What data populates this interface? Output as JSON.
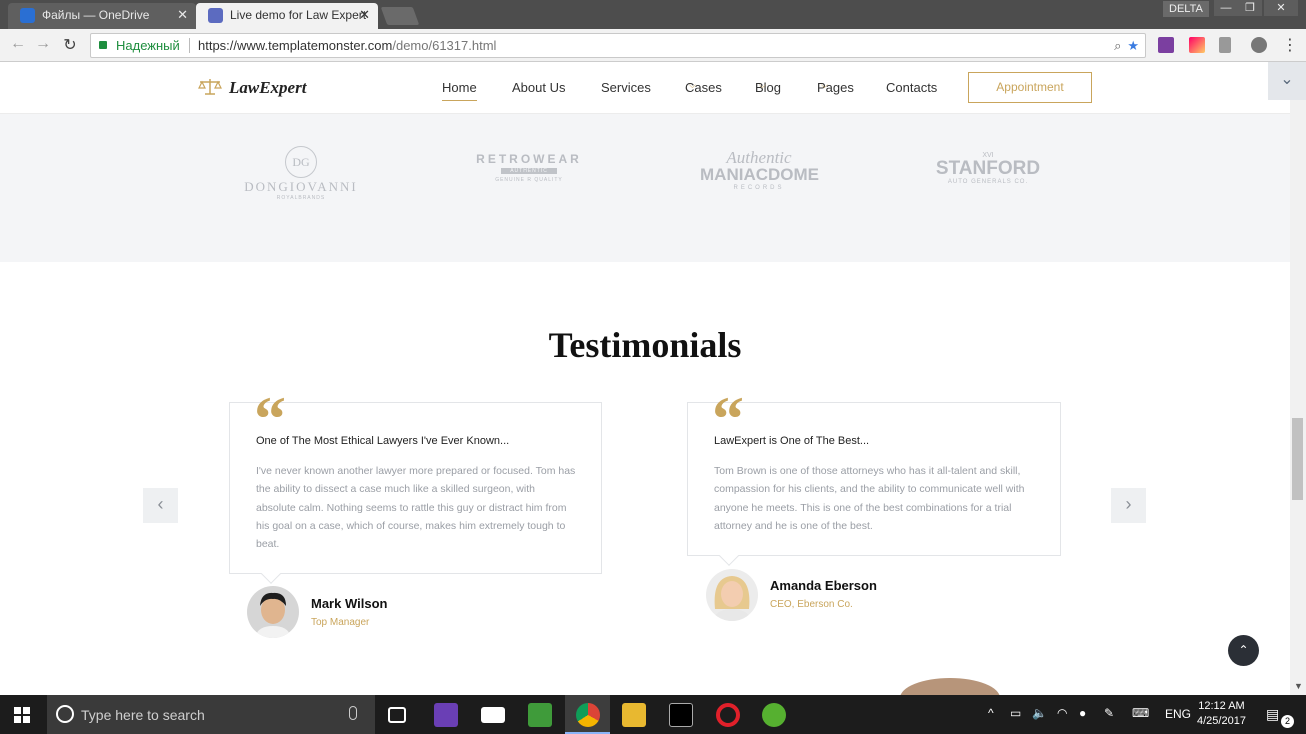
{
  "browser": {
    "tabs": [
      {
        "title": "Файлы — OneDrive",
        "active": false
      },
      {
        "title": "Live demo for Law Expert",
        "active": true
      }
    ],
    "profile": "DELTA",
    "secure_label": "Надежный",
    "url_host": "https://www.templatemonster.com",
    "url_path": "/demo/61317.html"
  },
  "site": {
    "brand": "LawExpert",
    "nav": [
      {
        "label": "Home",
        "dropdown": false,
        "current": true
      },
      {
        "label": "About Us",
        "dropdown": false
      },
      {
        "label": "Services",
        "dropdown": false
      },
      {
        "label": "Cases",
        "dropdown": true
      },
      {
        "label": "Blog",
        "dropdown": true
      },
      {
        "label": "Pages",
        "dropdown": true
      },
      {
        "label": "Contacts",
        "dropdown": false
      }
    ],
    "appointment_label": "Appointment",
    "partner_logos": [
      {
        "lines": [
          "DG",
          "DONGIOVANNI",
          "ROYALBRANDS"
        ]
      },
      {
        "lines": [
          "RETROWEAR",
          "AUTHENTIC",
          "GENUINE R QUALITY"
        ]
      },
      {
        "lines": [
          "Authentic",
          "MANIACDOME",
          "RECORDS"
        ]
      },
      {
        "lines": [
          "XVI",
          "STANFORD",
          "AUTO GENERALS CO."
        ]
      }
    ]
  },
  "testimonials": {
    "title": "Testimonials",
    "items": [
      {
        "headline": "One of The Most Ethical Lawyers I've Ever Known...",
        "body": "I've never known another lawyer more prepared or focused. Tom has the ability to dissect a case much like a skilled surgeon, with absolute calm. Nothing seems to rattle this guy or distract him from his goal on a case, which of course, makes him extremely tough to beat.",
        "name": "Mark Wilson",
        "role": "Top Manager"
      },
      {
        "headline": "LawExpert is One of The Best...",
        "body": "Tom Brown is one of those attorneys who has it all-talent and skill, compassion for his clients, and the ability to communicate well with anyone he meets. This is one of the best combinations for a trial attorney and he is one of the best.",
        "name": "Amanda Eberson",
        "role": "CEO, Eberson Co."
      }
    ]
  },
  "taskbar": {
    "search_placeholder": "Type here to search",
    "language": "ENG",
    "time": "12:12 AM",
    "date": "4/25/2017",
    "notifications": "2"
  },
  "colors": {
    "accent_gold": "#c9a55c",
    "brand_band": "#f4f5f7",
    "taskbar": "#1c1c1c"
  }
}
